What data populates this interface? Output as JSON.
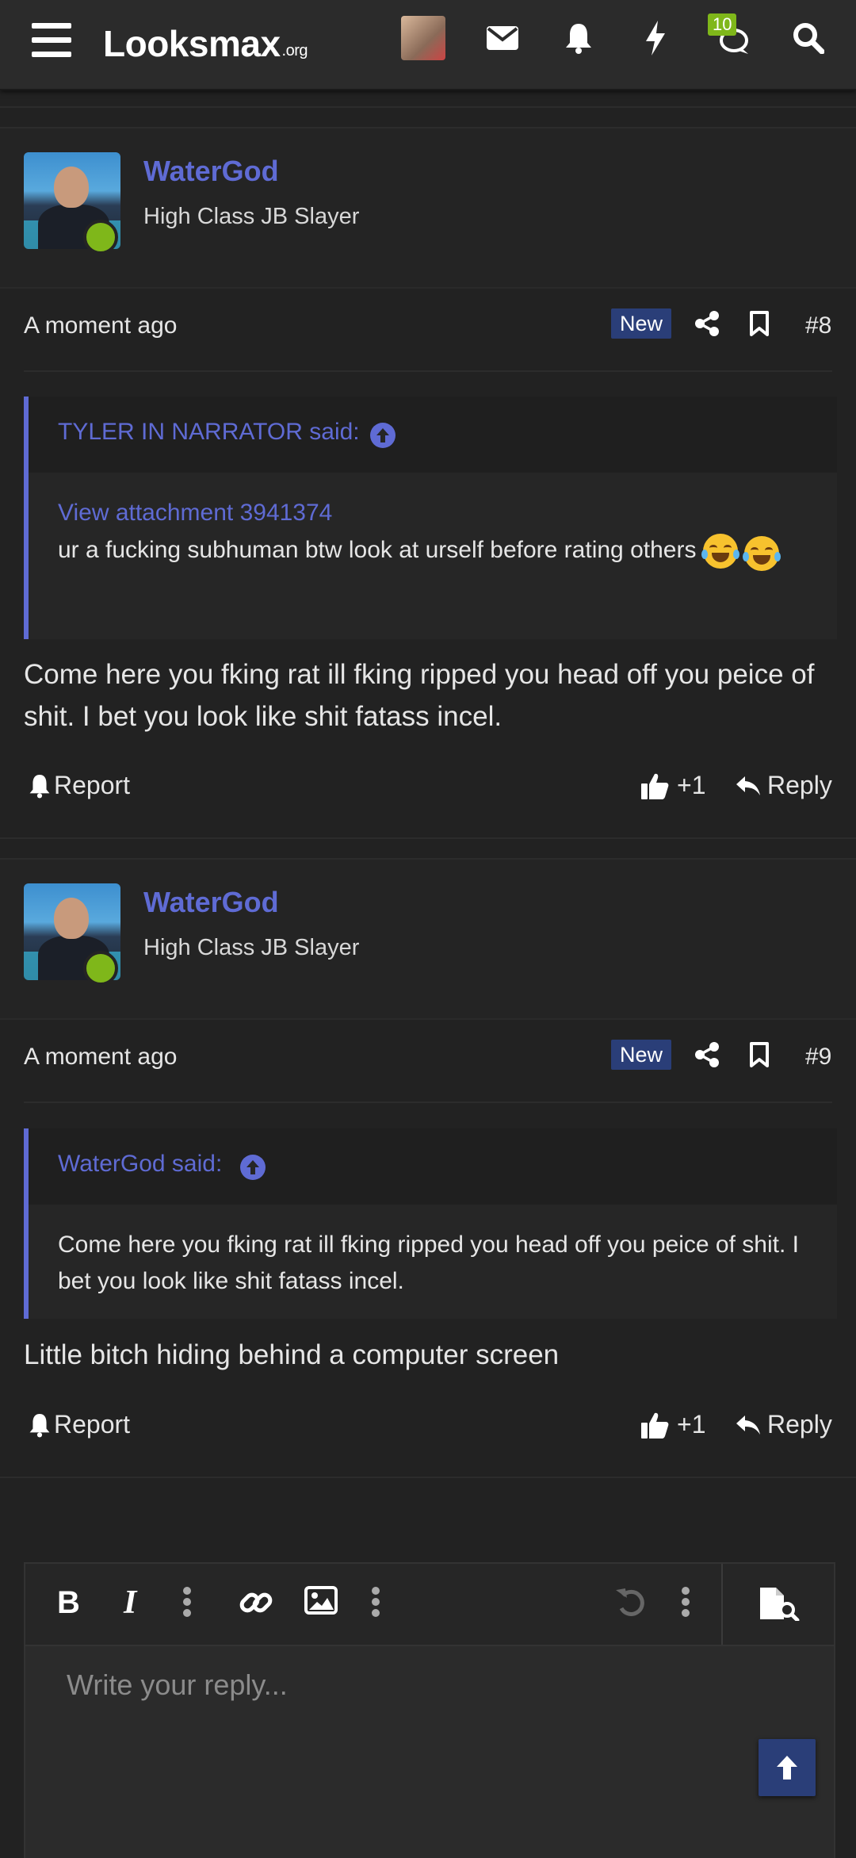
{
  "header": {
    "logo_main": "Lᴏoksmax",
    "logo_suffix": ".org",
    "conversations_count": "10"
  },
  "posts": [
    {
      "username": "WaterGod",
      "user_title": "High Class JB Slayer",
      "time": "A moment ago",
      "new_label": "New",
      "post_number": "#8",
      "quote": {
        "author": "TYLER IN NARRATOR said:",
        "attachment": "View attachment 3941374",
        "text": "ur a fucking subhuman btw look at urself before rating others"
      },
      "body": "Come here you fking rat ill fking ripped you head off you peice of shit. I bet you look like shit fatass incel.",
      "report_label": "Report",
      "like_count": "+1",
      "reply_label": "Reply"
    },
    {
      "username": "WaterGod",
      "user_title": "High Class JB Slayer",
      "time": "A moment ago",
      "new_label": "New",
      "post_number": "#9",
      "quote": {
        "author": "WaterGod said:",
        "text": "Come here you fking rat ill fking ripped you head off you peice of shit. I bet you look like shit fatass incel."
      },
      "body": "Little bitch hiding behind a computer screen",
      "report_label": "Report",
      "like_count": "+1",
      "reply_label": "Reply"
    }
  ],
  "editor": {
    "placeholder": "Write your reply..."
  },
  "colors": {
    "accent": "#5f6bd4",
    "background": "#222222",
    "online": "#7fb71a",
    "new_badge": "#2a3e78"
  }
}
